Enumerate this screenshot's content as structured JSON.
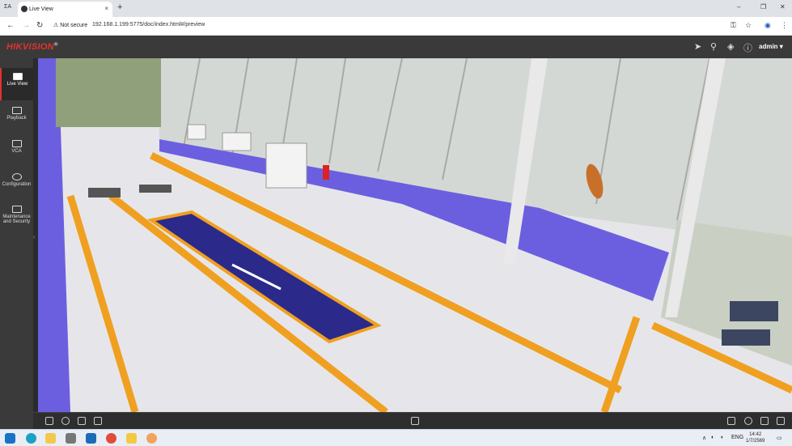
{
  "browser": {
    "profile_label": "ΣA",
    "tab_title": "Live View",
    "tab_close": "×",
    "new_tab": "+",
    "security_label": "Not secure",
    "url": "192.168.1.199:5775/doc/index.html#/preview",
    "window_controls": [
      "–",
      "❐",
      "✕"
    ]
  },
  "app": {
    "brand": "HIKVISION",
    "brand_mark": "®",
    "user": "admin ▾",
    "header_icons": [
      "send-icon",
      "search-icon",
      "theme-icon",
      "info-icon"
    ]
  },
  "nav": [
    {
      "label": "Live View",
      "icon": "monitor-icon",
      "active": true
    },
    {
      "label": "Playback",
      "icon": "playback-icon",
      "active": false
    },
    {
      "label": "VCA",
      "icon": "vca-icon",
      "active": false
    },
    {
      "label": "Configuration",
      "icon": "gear-icon",
      "active": false
    },
    {
      "label": "Maintenance and Security",
      "icon": "wrench-icon",
      "active": false
    }
  ],
  "video_toolbar": {
    "left_icons": [
      "capture-icon",
      "zoom-icon",
      "snapshot-icon",
      "region-icon"
    ],
    "center_icon": "fullscreen-window-icon",
    "right_icons": [
      "ptz-icon",
      "record-icon",
      "window-layout-icon",
      "fullscreen-icon"
    ]
  },
  "taskbar": {
    "tray_language": "ENG",
    "time": "14:42",
    "date": "1/7/2569",
    "tray_arrow": "∧"
  },
  "colors": {
    "brand_red": "#e5322d",
    "header_bg": "#3a3a3a",
    "wall_purple": "#6b5fe0",
    "floor_stripe": "#f0a020"
  }
}
